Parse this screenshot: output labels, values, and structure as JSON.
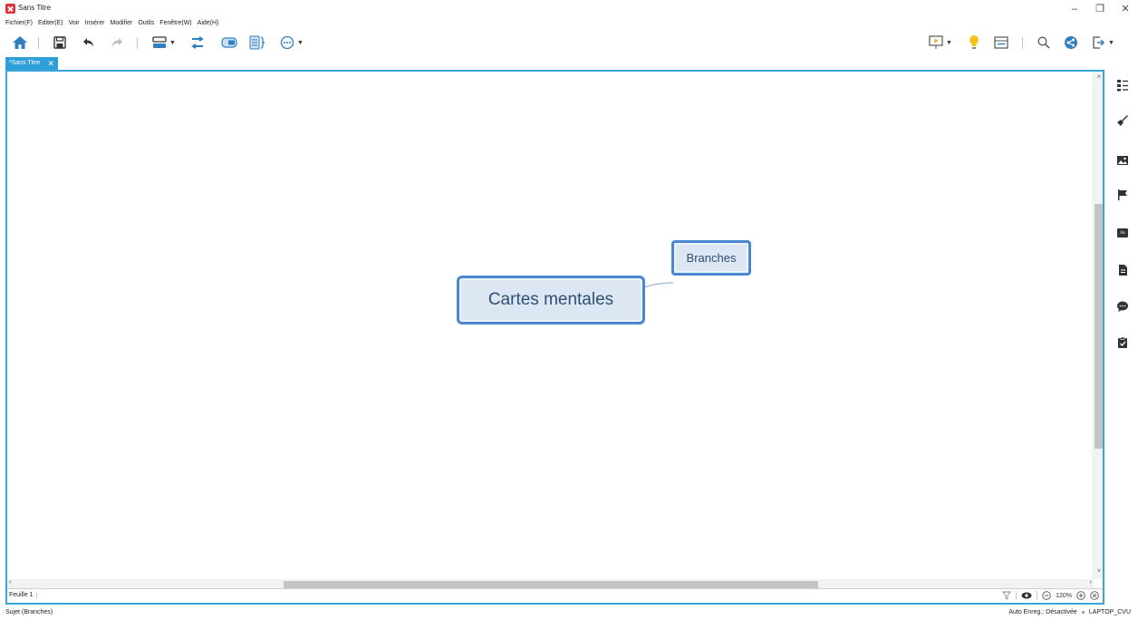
{
  "window": {
    "title": "Sans Titre",
    "controls": {
      "minimize": "–",
      "restore": "❐",
      "close": "✕"
    }
  },
  "menu": [
    "Fichier(F)",
    "Editer(E)",
    "Voir",
    "Insérer",
    "Modifier",
    "Outils",
    "Fenêtre(W)",
    "Aide(H)"
  ],
  "toolbar": {
    "left_icons": [
      "home-icon",
      "save-icon",
      "undo-icon",
      "redo-icon",
      "topic-icon",
      "relationship-icon",
      "boundary-icon",
      "summary-icon",
      "more-icon"
    ],
    "right_icons": [
      "presentation-icon",
      "idea-icon",
      "outline-view-icon",
      "search-icon",
      "share-icon",
      "export-icon"
    ]
  },
  "tab": {
    "label": "*Sans Titre",
    "close": "✕"
  },
  "map": {
    "central_topic": "Cartes mentales",
    "branch_topic": "Branches",
    "node_color": "#4a86d2",
    "node_fill": "#dde6f3"
  },
  "sheet": {
    "label": "Feuille 1"
  },
  "zoom": {
    "level": "120%",
    "minus": "−",
    "plus": "+"
  },
  "sidebar_icons": [
    "outline-icon",
    "format-brush-icon",
    "image-icon",
    "marker-flag-icon",
    "label-icon",
    "notes-icon",
    "comment-icon",
    "task-icon"
  ],
  "status": {
    "left": "Sujet (Branches)",
    "autosave": "Auto Enreg.: Désactivée",
    "user": "LAPTOP_CVU"
  },
  "colors": {
    "accent": "#3aa6dd",
    "tab": "#2e9fd8",
    "icon": "#2e7fc3",
    "idea": "#f6c01e"
  }
}
